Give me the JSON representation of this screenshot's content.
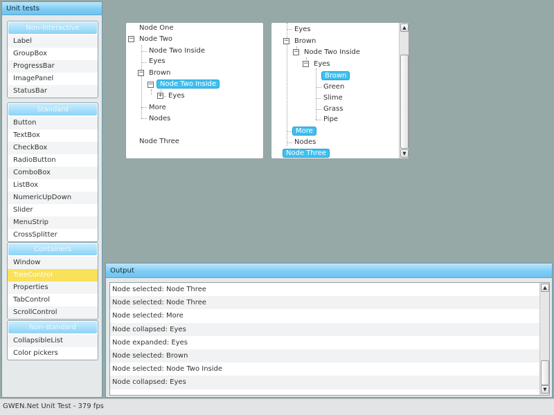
{
  "dock": {
    "title": "Unit tests",
    "groups": [
      {
        "header": "Non-Interactive",
        "items": [
          "Label",
          "GroupBox",
          "ProgressBar",
          "ImagePanel",
          "StatusBar"
        ]
      },
      {
        "header": "Standard",
        "items": [
          "Button",
          "TextBox",
          "CheckBox",
          "RadioButton",
          "ComboBox",
          "ListBox",
          "NumericUpDown",
          "Slider",
          "MenuStrip",
          "CrossSplitter"
        ]
      },
      {
        "header": "Containers",
        "items": [
          "Window",
          "TreeControl",
          "Properties",
          "TabControl",
          "ScrollControl"
        ],
        "selected": "TreeControl"
      },
      {
        "header": "Non-standard",
        "items": [
          "CollapsibleList",
          "Color pickers"
        ]
      }
    ]
  },
  "tree1": {
    "node_one": "Node One",
    "node_two": "Node Two",
    "node_two_inside": "Node Two Inside",
    "eyes": "Eyes",
    "brown": "Brown",
    "node_two_inside_sel": "Node Two Inside",
    "eyes_child": "Eyes",
    "more": "More",
    "nodes": "Nodes",
    "node_three": "Node Three"
  },
  "tree2": {
    "eyes_top": "Eyes",
    "brown": "Brown",
    "node_two_inside": "Node Two Inside",
    "eyes": "Eyes",
    "brown_sel": "Brown",
    "green": "Green",
    "slime": "Slime",
    "grass": "Grass",
    "pipe": "Pipe",
    "more_sel": "More",
    "nodes": "Nodes",
    "node_three_sel": "Node Three"
  },
  "output": {
    "title": "Output",
    "log": [
      "Node selected: Node Three",
      "Node selected: Node Three",
      "Node selected: More",
      "Node collapsed: Eyes",
      "Node expanded: Eyes",
      "Node selected: Brown",
      "Node selected: Node Two Inside",
      "Node collapsed: Eyes"
    ]
  },
  "status": {
    "text": "GWEN.Net Unit Test - 379 fps"
  },
  "icons": {
    "expanded": "−",
    "collapsed": "+",
    "scroll_up": "▲",
    "scroll_down": "▼"
  },
  "colors": {
    "accent": "#6cc3f1",
    "selected_item": "#f9e15a",
    "tree_selection": "#3fc0ef",
    "background": "#96a9a7"
  }
}
